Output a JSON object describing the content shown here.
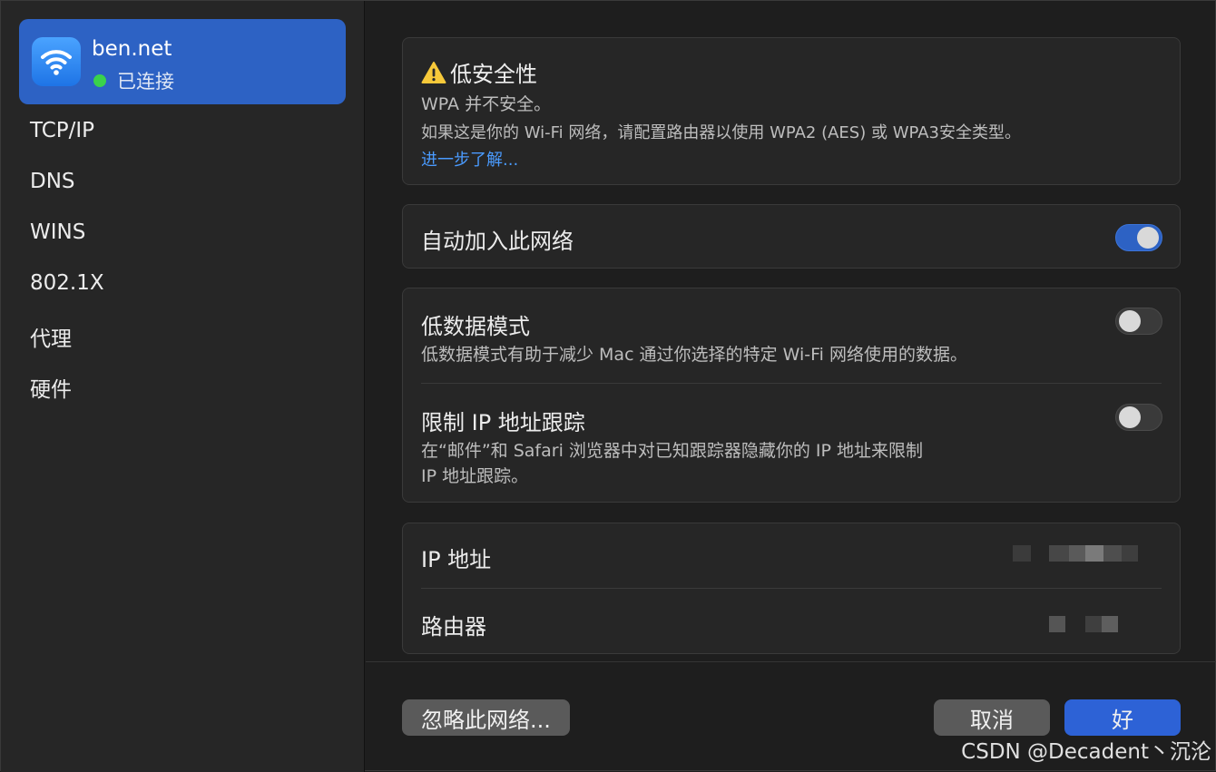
{
  "network": {
    "name": "ben.net",
    "status": "已连接",
    "status_color": "#3ad24b"
  },
  "sidebar": {
    "items": [
      {
        "label": "TCP/IP"
      },
      {
        "label": "DNS"
      },
      {
        "label": "WINS"
      },
      {
        "label": "802.1X"
      },
      {
        "label": "代理"
      },
      {
        "label": "硬件"
      }
    ]
  },
  "security": {
    "title": "低安全性",
    "line1": "WPA 并不安全。",
    "line2": "如果这是你的 Wi-Fi 网络，请配置路由器以使用 WPA2 (AES) 或 WPA3安全类型。",
    "link": "进一步了解..."
  },
  "auto_join": {
    "label": "自动加入此网络",
    "enabled": true
  },
  "low_data": {
    "label": "低数据模式",
    "description": "低数据模式有助于减少 Mac 通过你选择的特定 Wi-Fi 网络使用的数据。",
    "enabled": false
  },
  "limit_ip": {
    "label": "限制 IP 地址跟踪",
    "description_line1": "在“邮件”和 Safari 浏览器中对已知跟踪器隐藏你的 IP 地址来限制",
    "description_line2": "IP 地址跟踪。",
    "enabled": false
  },
  "addresses": {
    "ip_label": "IP 地址",
    "router_label": "路由器"
  },
  "buttons": {
    "forget": "忽略此网络...",
    "cancel": "取消",
    "ok": "好"
  },
  "watermark": "CSDN @Decadent丶沉沦",
  "colors": {
    "accent": "#2d62c4",
    "link": "#4a9bff",
    "primary_button": "#2d62d6"
  }
}
